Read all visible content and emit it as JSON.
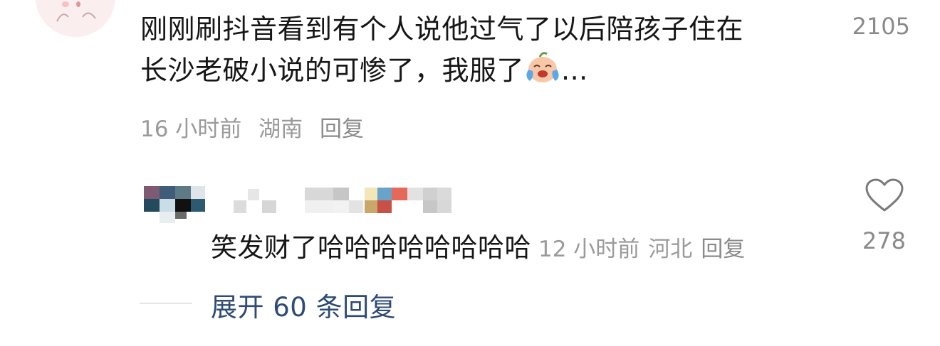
{
  "top_comment": {
    "text_line1": "刚刚刷抖音看到有个人说他过气了以后陪孩子住在",
    "text_line2": "长沙老破小说的可惨了，我服了",
    "ellipsis": "...",
    "emoji": "crying-laughing-emoji",
    "like_count": "2105",
    "time": "16 小时前",
    "location": "湖南",
    "reply_label": "回复"
  },
  "reply": {
    "text": "笑发财了哈哈哈哈哈哈哈哈",
    "time": "12 小时前",
    "location": "河北",
    "reply_label": "回复",
    "like_count": "278",
    "like_icon": "heart-outline-icon"
  },
  "expand": {
    "label": "展开 60 条回复"
  },
  "colors": {
    "text_primary": "#161616",
    "text_meta": "#9a9a9a",
    "link_blue": "#2f4b75"
  }
}
